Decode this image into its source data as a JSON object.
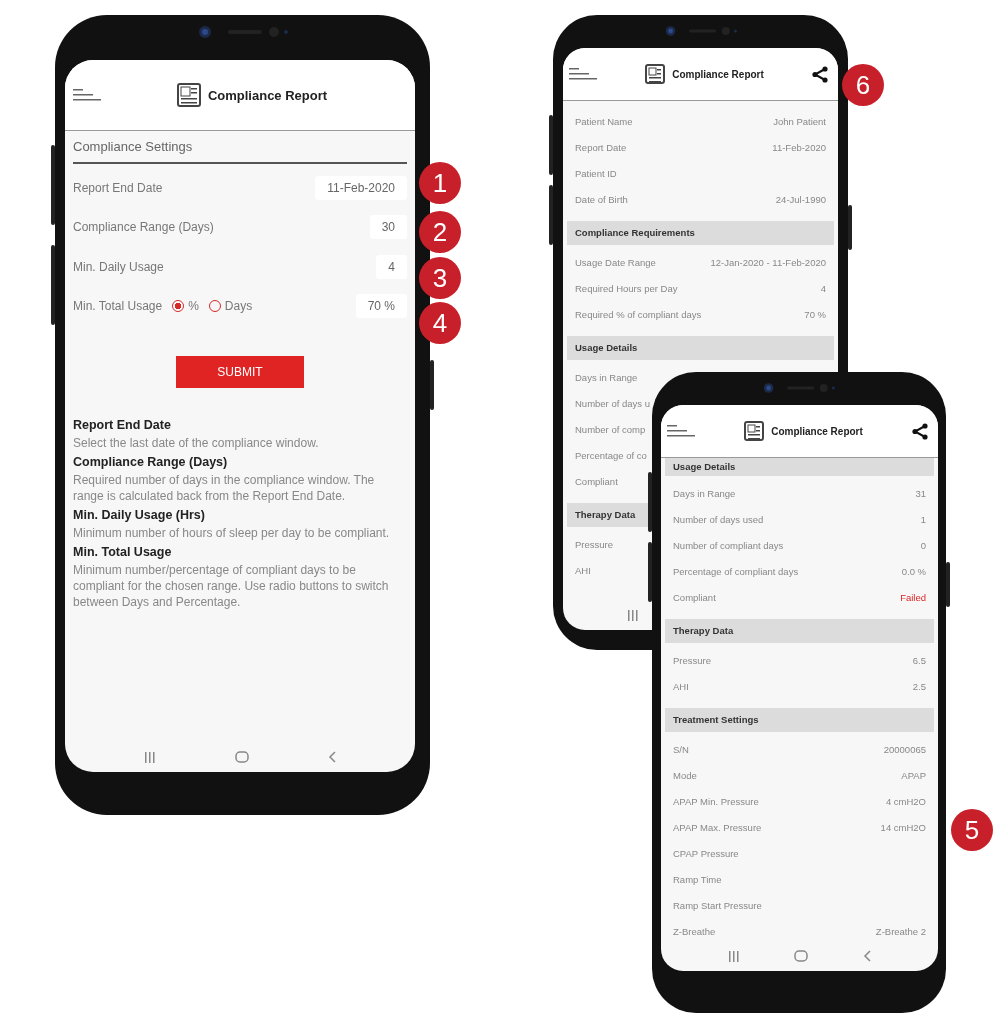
{
  "phones": [
    {
      "kind": "settings",
      "header": {
        "title": "Compliance Report"
      },
      "section": "Compliance Settings",
      "settings": [
        {
          "label": "Report End Date",
          "value": "11-Feb-2020"
        },
        {
          "label": "Compliance Range (Days)",
          "value": "30"
        },
        {
          "label": "Min. Daily Usage",
          "value": "4"
        },
        {
          "label": "Min. Total Usage",
          "options": [
            {
              "label": "%",
              "selected": true
            },
            {
              "label": "Days",
              "selected": false
            }
          ],
          "value": "70 %"
        }
      ],
      "submit": "SUBMIT",
      "help": [
        {
          "heading": "Report End Date",
          "text": "Select the last date of the compliance window."
        },
        {
          "heading": "Compliance Range (Days)",
          "text": "Required number of days in the compliance window. The range is calculated back from the Report End Date."
        },
        {
          "heading": "Min. Daily Usage (Hrs)",
          "text": "Minimum number of hours of sleep per day to be compliant."
        },
        {
          "heading": "Min. Total Usage",
          "text": "Minimum number/percentage of compliant days to be compliant for the chosen range. Use radio buttons to switch between Days and Percentage."
        }
      ]
    },
    {
      "kind": "report",
      "header": {
        "title": "Compliance Report",
        "share": true
      },
      "items": [
        {
          "kind": "row",
          "label": "Patient Name",
          "value": "John Patient"
        },
        {
          "kind": "row",
          "label": "Report Date",
          "value": "11-Feb-2020"
        },
        {
          "kind": "row",
          "label": "Patient ID"
        },
        {
          "kind": "row",
          "label": "Date of Birth",
          "value": "24-Jul-1990"
        },
        {
          "kind": "heading",
          "label": "Compliance Requirements"
        },
        {
          "kind": "row",
          "label": "Usage Date Range",
          "value": "12-Jan-2020 - 11-Feb-2020"
        },
        {
          "kind": "row",
          "label": "Required Hours per Day",
          "value": "4"
        },
        {
          "kind": "row",
          "label": "Required % of compliant days",
          "value": "70 %"
        },
        {
          "kind": "heading",
          "label": "Usage Details"
        },
        {
          "kind": "row",
          "label": "Days in Range"
        },
        {
          "kind": "row",
          "label": "Number of days u"
        },
        {
          "kind": "row",
          "label": "Number of comp"
        },
        {
          "kind": "row",
          "label": "Percentage of co"
        },
        {
          "kind": "row",
          "label": "Compliant"
        },
        {
          "kind": "heading",
          "label": "Therapy Data"
        },
        {
          "kind": "row",
          "label": "Pressure"
        },
        {
          "kind": "row",
          "label": "AHI"
        }
      ]
    },
    {
      "kind": "report",
      "header": {
        "title": "Compliance Report",
        "share": true
      },
      "items": [
        {
          "kind": "heading",
          "label": "Usage Details"
        },
        {
          "kind": "row",
          "label": "Days in Range",
          "value": "31"
        },
        {
          "kind": "row",
          "label": "Number of days used",
          "value": "1"
        },
        {
          "kind": "row",
          "label": "Number of compliant days",
          "value": "0"
        },
        {
          "kind": "row",
          "label": "Percentage of compliant days",
          "value": "0.0 %"
        },
        {
          "kind": "status-row",
          "label": "Compliant",
          "value": "Failed"
        },
        {
          "kind": "heading",
          "label": "Therapy Data"
        },
        {
          "kind": "row",
          "label": "Pressure",
          "value": "6.5"
        },
        {
          "kind": "row",
          "label": "AHI",
          "value": "2.5"
        },
        {
          "kind": "heading",
          "label": "Treatment Settings"
        },
        {
          "kind": "row",
          "label": "S/N",
          "value": "20000065"
        },
        {
          "kind": "row",
          "label": "Mode",
          "value": "APAP"
        },
        {
          "kind": "row",
          "label": "APAP Min. Pressure",
          "value": "4 cmH2O"
        },
        {
          "kind": "row",
          "label": "APAP Max. Pressure",
          "value": "14 cmH2O"
        },
        {
          "kind": "row",
          "label": "CPAP Pressure"
        },
        {
          "kind": "row",
          "label": "Ramp Time"
        },
        {
          "kind": "row",
          "label": "Ramp Start Pressure"
        },
        {
          "kind": "row",
          "label": "Z-Breathe",
          "value": "Z-Breathe 2"
        }
      ]
    }
  ],
  "callouts": [
    "1",
    "2",
    "3",
    "4",
    "5",
    "6"
  ]
}
